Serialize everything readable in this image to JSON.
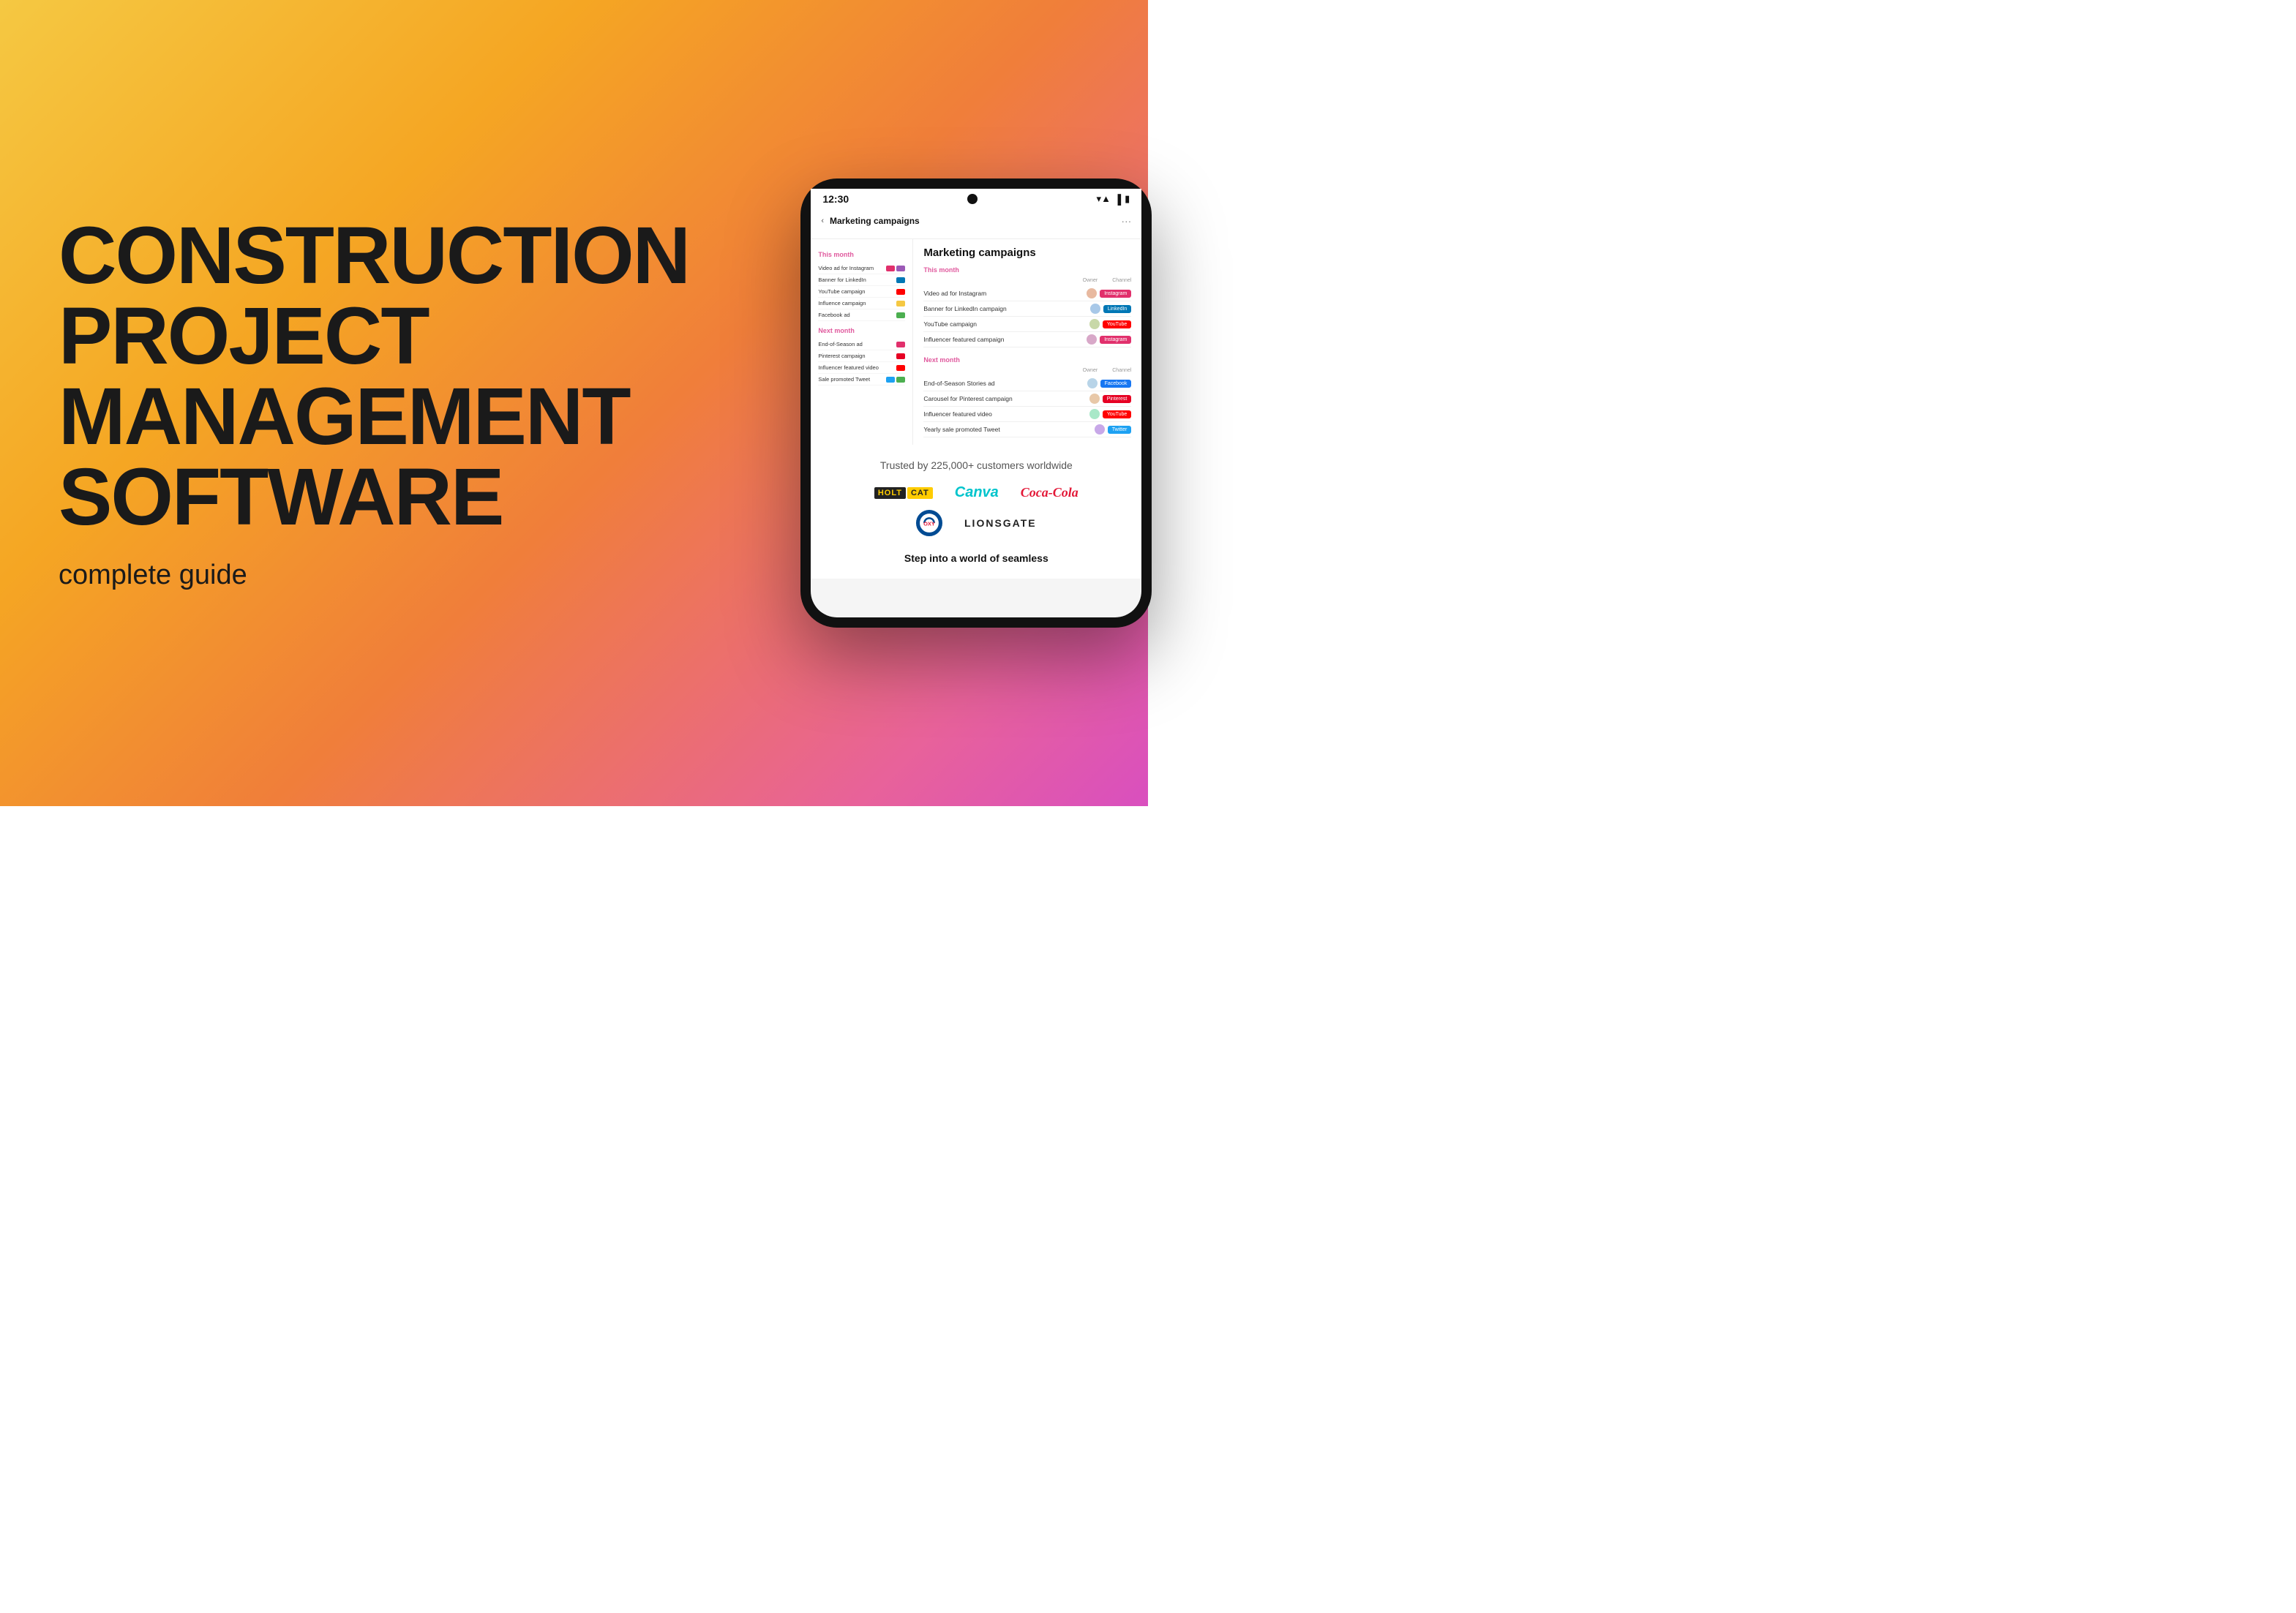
{
  "background": {
    "gradient_start": "#F5C842",
    "gradient_end": "#D94FBF"
  },
  "left": {
    "line1": "CONSTRUCTION",
    "line2": "PROJECT",
    "line3": "MANAGEMENT",
    "line4": "SOFTWARE",
    "subtitle": "complete guide"
  },
  "phone": {
    "time": "12:30",
    "app": {
      "title": "Marketing campaigns",
      "trusted_text": "Trusted by 225,000+ customers worldwide",
      "step_into_text": "Step into a world of seamless",
      "this_month_label": "This month",
      "next_month_label": "Next month",
      "table_headers": {
        "owner": "Owner",
        "channel": "Channel"
      },
      "this_month_items": [
        {
          "name": "Video ad for Instagram",
          "badge": "Instagram",
          "badge_class": "badge-instagram"
        },
        {
          "name": "Banner for LinkedIn campaign",
          "badge": "LinkedIn",
          "badge_class": "badge-linkedin"
        },
        {
          "name": "YouTube campaign",
          "badge": "YouTube",
          "badge_class": "badge-youtube"
        },
        {
          "name": "Influencer featured campaign",
          "badge": "Instagram",
          "badge_class": "badge-instagram"
        }
      ],
      "next_month_items": [
        {
          "name": "End-of-Season Stories ad",
          "badge": "Facebook",
          "badge_class": "badge-facebook"
        },
        {
          "name": "Carousel for Pinterest campaign",
          "badge": "Pinterest",
          "badge_class": "badge-pinterest"
        },
        {
          "name": "Influencer featured video",
          "badge": "YouTube",
          "badge_class": "badge-youtube"
        },
        {
          "name": "Yearly sale promoted Tweet",
          "badge": "Twitter",
          "badge_class": "badge-twitter"
        }
      ],
      "sidebar_this_month": [
        {
          "name": "Video ad for Instagram"
        },
        {
          "name": "Banner for LinkedIn"
        },
        {
          "name": "YouTube campaign"
        },
        {
          "name": "Influence campaign"
        },
        {
          "name": "Facebook ad"
        }
      ],
      "sidebar_next_month": [
        {
          "name": "End-of-Season ad"
        },
        {
          "name": "Pinterest campaign"
        },
        {
          "name": "Influencer featured video"
        },
        {
          "name": "Sale promoted Tweet"
        }
      ],
      "logos": {
        "holtcat": "HOLT CAT",
        "canva": "Canva",
        "cocacola": "Coca-Cola",
        "oxy": "OXY",
        "lionsgate": "LIONSGATE"
      }
    }
  }
}
